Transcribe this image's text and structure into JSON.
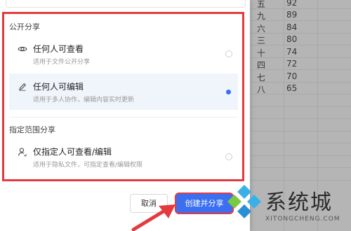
{
  "sheet": {
    "rows": [
      {
        "c1": "五",
        "c2": "92"
      },
      {
        "c1": "九",
        "c2": "89"
      },
      {
        "c1": "六",
        "c2": "84"
      },
      {
        "c1": "三",
        "c2": "80"
      },
      {
        "c1": "十",
        "c2": "74"
      },
      {
        "c1": "四",
        "c2": "72"
      },
      {
        "c1": "七",
        "c2": "70"
      },
      {
        "c1": "八",
        "c2": "65"
      }
    ]
  },
  "dialog": {
    "public_section_title": "公开分享",
    "specified_section_title": "指定范围分享",
    "options": [
      {
        "icon": "eye-icon",
        "title": "任何人可查看",
        "desc": "适用于文件公开分享",
        "selected": false
      },
      {
        "icon": "pencil-icon",
        "title": "任何人可编辑",
        "desc": "适用于多人协作，编辑内容实时更新",
        "selected": true
      },
      {
        "icon": "user-icon",
        "title": "仅指定人可查看/编辑",
        "desc": "适用于隐私文件，可指定查看/编辑权限",
        "selected": false
      }
    ],
    "cancel_label": "取消",
    "create_label": "创建并分享"
  },
  "watermark": {
    "text": "系统城",
    "sub": "XITONGCHENG.COM"
  },
  "colors": {
    "accent": "#3b6ff0",
    "highlight_red": "#e43a3f"
  }
}
